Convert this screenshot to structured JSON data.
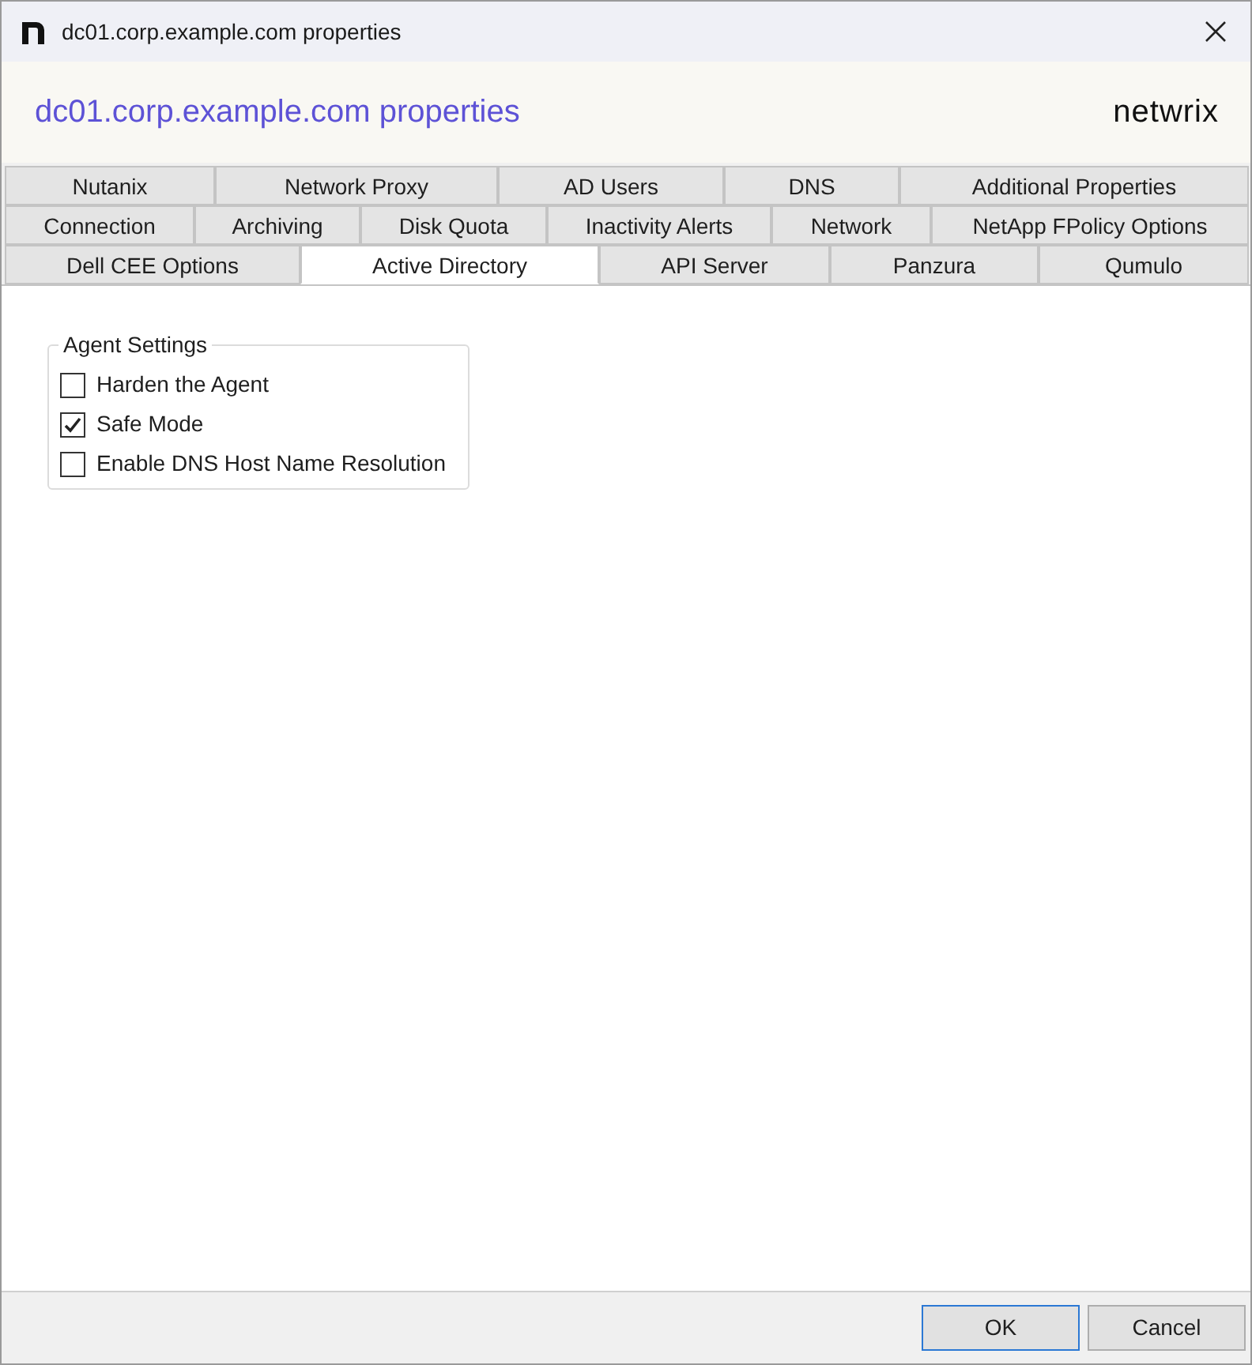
{
  "window": {
    "title": "dc01.corp.example.com properties"
  },
  "header": {
    "title": "dc01.corp.example.com properties",
    "logo": "netwrix"
  },
  "tab_rows": [
    [
      {
        "label": "Nutanix",
        "selected": false
      },
      {
        "label": "Network Proxy",
        "selected": false
      },
      {
        "label": "AD Users",
        "selected": false
      },
      {
        "label": "DNS",
        "selected": false
      },
      {
        "label": "Additional Properties",
        "selected": false
      }
    ],
    [
      {
        "label": "Connection",
        "selected": false
      },
      {
        "label": "Archiving",
        "selected": false
      },
      {
        "label": "Disk Quota",
        "selected": false
      },
      {
        "label": "Inactivity Alerts",
        "selected": false
      },
      {
        "label": "Network",
        "selected": false
      },
      {
        "label": "NetApp FPolicy Options",
        "selected": false
      }
    ],
    [
      {
        "label": "Dell CEE Options",
        "selected": false
      },
      {
        "label": "Active Directory",
        "selected": true
      },
      {
        "label": "API Server",
        "selected": false
      },
      {
        "label": "Panzura",
        "selected": false
      },
      {
        "label": "Qumulo",
        "selected": false
      }
    ]
  ],
  "group": {
    "title": "Agent Settings",
    "options": [
      {
        "label": "Harden the Agent",
        "checked": false
      },
      {
        "label": "Safe Mode",
        "checked": true
      },
      {
        "label": "Enable DNS Host Name Resolution",
        "checked": false
      }
    ]
  },
  "buttons": [
    {
      "label": "OK",
      "kind": "default"
    },
    {
      "label": "Cancel",
      "kind": "normal"
    }
  ]
}
